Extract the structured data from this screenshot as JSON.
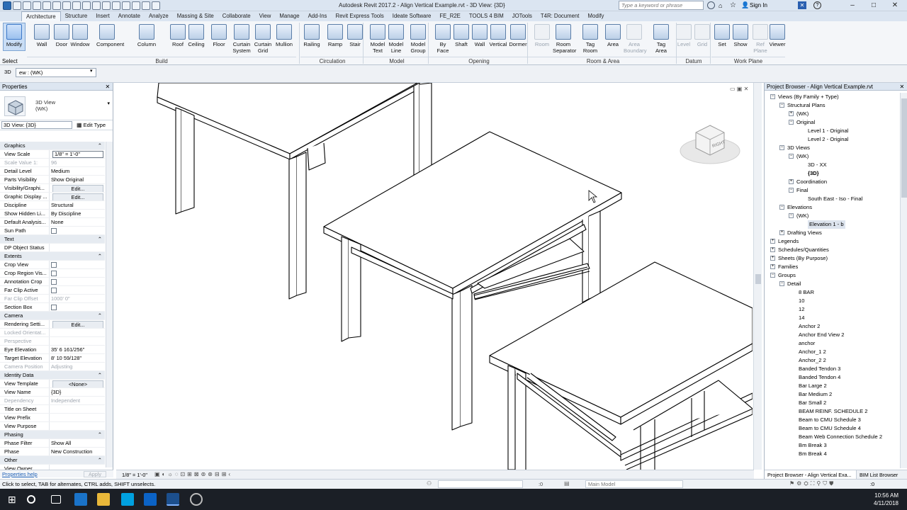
{
  "window": {
    "title": "Autodesk Revit 2017.2 -    Align Vertical Example.rvt - 3D View: {3D}",
    "search_placeholder": "Type a keyword or phrase",
    "sign_in": "Sign In"
  },
  "tabs": [
    "Architecture",
    "Structure",
    "Insert",
    "Annotate",
    "Analyze",
    "Massing & Site",
    "Collaborate",
    "View",
    "Manage",
    "Add-Ins",
    "Revit Express Tools",
    "Ideate Software",
    "FE_R2E",
    "TOOLS 4 BIM",
    "JOTools",
    "T4R: Document",
    "Modify"
  ],
  "active_tab": "Architecture",
  "ribbon": {
    "select_label": "Select",
    "buttons": [
      {
        "label": "Modify"
      },
      {
        "label": "Wall"
      },
      {
        "label": "Door"
      },
      {
        "label": "Window"
      },
      {
        "label": "Component"
      },
      {
        "label": "Column"
      },
      {
        "label": "Roof"
      },
      {
        "label": "Ceiling"
      },
      {
        "label": "Floor"
      },
      {
        "label": "Curtain\nSystem"
      },
      {
        "label": "Curtain\nGrid"
      },
      {
        "label": "Mullion"
      },
      {
        "label": "Railing"
      },
      {
        "label": "Ramp"
      },
      {
        "label": "Stair"
      },
      {
        "label": "Model\nText"
      },
      {
        "label": "Model\nLine"
      },
      {
        "label": "Model\nGroup"
      },
      {
        "label": "By\nFace"
      },
      {
        "label": "Shaft"
      },
      {
        "label": "Wall"
      },
      {
        "label": "Vertical"
      },
      {
        "label": "Dormer"
      },
      {
        "label": "Room"
      },
      {
        "label": "Room\nSeparator"
      },
      {
        "label": "Tag\nRoom"
      },
      {
        "label": "Area"
      },
      {
        "label": "Area\nBoundary"
      },
      {
        "label": "Tag\nArea"
      },
      {
        "label": "Level"
      },
      {
        "label": "Grid"
      },
      {
        "label": "Set"
      },
      {
        "label": "Show"
      },
      {
        "label": "Ref\nPlane"
      },
      {
        "label": "Viewer"
      }
    ],
    "groups": [
      "Build",
      "Circulation",
      "Model",
      "Opening",
      "Room & Area",
      "Datum",
      "Work Plane"
    ]
  },
  "options_bar": {
    "view_label": "3D",
    "view_value": "ew : (WK)"
  },
  "properties": {
    "header": "Properties",
    "type_name": "3D View\n(WK)",
    "type_selector": "3D View: {3D}",
    "edit_type": "Edit Type",
    "rows": [
      {
        "kind": "sec",
        "k": "Graphics"
      },
      {
        "k": "View Scale",
        "v": "1/8\" = 1'-0\"",
        "box": true
      },
      {
        "k": "Scale Value    1:",
        "v": "96",
        "gray": true
      },
      {
        "k": "Detail Level",
        "v": "Medium"
      },
      {
        "k": "Parts Visibility",
        "v": "Show Original"
      },
      {
        "k": "Visibility/Graphi...",
        "v": "Edit...",
        "btn": true
      },
      {
        "k": "Graphic Display ...",
        "v": "Edit...",
        "btn": true
      },
      {
        "k": "Discipline",
        "v": "Structural"
      },
      {
        "k": "Show Hidden Li...",
        "v": "By Discipline"
      },
      {
        "k": "Default Analysis...",
        "v": "None"
      },
      {
        "k": "Sun Path",
        "v": "",
        "chk": true
      },
      {
        "kind": "sec",
        "k": "Text"
      },
      {
        "k": "DP Object Status",
        "v": ""
      },
      {
        "kind": "sec",
        "k": "Extents"
      },
      {
        "k": "Crop View",
        "v": "",
        "chk": true
      },
      {
        "k": "Crop Region Vis...",
        "v": "",
        "chk": true
      },
      {
        "k": "Annotation Crop",
        "v": "",
        "chk": true
      },
      {
        "k": "Far Clip Active",
        "v": "",
        "chk": true
      },
      {
        "k": "Far Clip Offset",
        "v": "1000' 0\"",
        "gray": true
      },
      {
        "k": "Section Box",
        "v": "",
        "chk": true
      },
      {
        "kind": "sec",
        "k": "Camera"
      },
      {
        "k": "Rendering Setti...",
        "v": "Edit...",
        "btn": true
      },
      {
        "k": "Locked Orientat...",
        "v": "",
        "gray": true
      },
      {
        "k": "Perspective",
        "v": "",
        "gray": true
      },
      {
        "k": "Eye Elevation",
        "v": "35'  6 161/256\""
      },
      {
        "k": "Target Elevation",
        "v": "8'  10 59/128\""
      },
      {
        "k": "Camera Position",
        "v": "Adjusting",
        "gray": true
      },
      {
        "kind": "sec",
        "k": "Identity Data"
      },
      {
        "k": "View Template",
        "v": "<None>",
        "btn": true
      },
      {
        "k": "View Name",
        "v": "{3D}"
      },
      {
        "k": "Dependency",
        "v": "Independent",
        "gray": true
      },
      {
        "k": "Title on Sheet",
        "v": ""
      },
      {
        "k": "View Prefix",
        "v": ""
      },
      {
        "k": "View Purpose",
        "v": ""
      },
      {
        "kind": "sec",
        "k": "Phasing"
      },
      {
        "k": "Phase Filter",
        "v": "Show All"
      },
      {
        "k": "Phase",
        "v": "New Construction"
      },
      {
        "kind": "sec",
        "k": "Other"
      },
      {
        "k": "View Owner",
        "v": ""
      }
    ],
    "help": "Properties help",
    "apply": "Apply"
  },
  "view_scale_label": "1/8\" = 1'-0\"",
  "browser": {
    "header": "Project Browser - Align Vertical Example.rvt",
    "tree": [
      {
        "d": 0,
        "t": "-",
        "l": "Views (By Family + Type)"
      },
      {
        "d": 1,
        "t": "-",
        "l": "Structural Plans"
      },
      {
        "d": 2,
        "t": "+",
        "l": "(WK)"
      },
      {
        "d": 2,
        "t": "-",
        "l": "Original"
      },
      {
        "d": 3,
        "l": "Level 1 - Original"
      },
      {
        "d": 3,
        "l": "Level 2 - Original"
      },
      {
        "d": 1,
        "t": "-",
        "l": "3D Views"
      },
      {
        "d": 2,
        "t": "-",
        "l": "(WK)"
      },
      {
        "d": 3,
        "l": "3D - XX"
      },
      {
        "d": 3,
        "l": "{3D}",
        "b": true
      },
      {
        "d": 2,
        "t": "+",
        "l": "Coordination"
      },
      {
        "d": 2,
        "t": "-",
        "l": "Final"
      },
      {
        "d": 3,
        "l": "South East - Iso - Final"
      },
      {
        "d": 1,
        "t": "-",
        "l": "Elevations"
      },
      {
        "d": 2,
        "t": "-",
        "l": "(WK)"
      },
      {
        "d": 3,
        "l": "Elevation 1 - b",
        "sel": true
      },
      {
        "d": 1,
        "t": "+",
        "l": "Drafting Views"
      },
      {
        "d": 0,
        "t": "+",
        "l": "Legends"
      },
      {
        "d": 0,
        "t": "+",
        "l": "Schedules/Quantities"
      },
      {
        "d": 0,
        "t": "+",
        "l": "Sheets (By Purpose)"
      },
      {
        "d": 0,
        "t": "+",
        "l": "Families"
      },
      {
        "d": 0,
        "t": "-",
        "l": "Groups"
      },
      {
        "d": 1,
        "t": "-",
        "l": "Detail"
      },
      {
        "d": 2,
        "l": "8 BAR"
      },
      {
        "d": 2,
        "l": "10"
      },
      {
        "d": 2,
        "l": "12"
      },
      {
        "d": 2,
        "l": "14"
      },
      {
        "d": 2,
        "l": "Anchor 2"
      },
      {
        "d": 2,
        "l": "Anchor End View 2"
      },
      {
        "d": 2,
        "l": "anchor"
      },
      {
        "d": 2,
        "l": "Anchor_1 2"
      },
      {
        "d": 2,
        "l": "Anchor_2 2"
      },
      {
        "d": 2,
        "l": "Banded Tendon 3"
      },
      {
        "d": 2,
        "l": "Banded Tendon 4"
      },
      {
        "d": 2,
        "l": "Bar Large 2"
      },
      {
        "d": 2,
        "l": "Bar Medium 2"
      },
      {
        "d": 2,
        "l": "Bar Small 2"
      },
      {
        "d": 2,
        "l": "BEAM REINF. SCHEDULE 2"
      },
      {
        "d": 2,
        "l": "Beam to CMU Schedule 3"
      },
      {
        "d": 2,
        "l": "Beam to CMU Schedule 4"
      },
      {
        "d": 2,
        "l": "Beam Web Connection Schedule 2"
      },
      {
        "d": 2,
        "l": "Bm Break 3"
      },
      {
        "d": 2,
        "l": "Bm Break 4"
      }
    ],
    "tab1": "Project Browser - Align Vertical Exa...",
    "tab2": "BIM List Browser"
  },
  "viewcube": {
    "label": "RIGHT"
  },
  "status": {
    "text": "Click to select, TAB for alternates, CTRL adds, SHIFT unselects.",
    "zero": ":0",
    "model": "Main Model",
    "filter": ":0"
  },
  "taskbar": {
    "time": "10:56 AM",
    "date": "4/11/2018"
  }
}
